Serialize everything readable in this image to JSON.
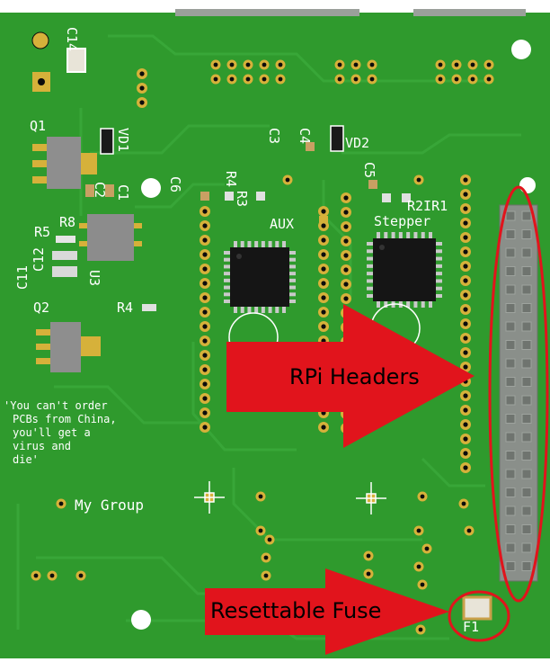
{
  "callouts": {
    "rpi_headers": "RPi Headers",
    "resettable_fuse": "Resettable Fuse"
  },
  "silkscreen": {
    "c14": "C14",
    "q1": "Q1",
    "vd1": "VD1",
    "c2": "C2",
    "c1": "C1",
    "r8": "R8",
    "r5": "R5",
    "c12": "C12",
    "c11": "C11",
    "u3": "U3",
    "q2": "Q2",
    "r4_left": "R4",
    "c3": "C3",
    "c4": "C4",
    "vd2": "VD2",
    "c6": "C6",
    "r4": "R4",
    "r3": "R3",
    "c5": "C5",
    "r2ir1": "R2IR1",
    "aux": "AUX",
    "stepper": "Stepper",
    "f1": "F1",
    "my_group": "My Group",
    "note_line1": "'You can't order",
    "note_line2": "PCBs from China,",
    "note_line3": "you'll get a",
    "note_line4": "virus and",
    "note_line5": "die'"
  },
  "colors": {
    "board": "#2f9a2d",
    "trace": "#3aa83a",
    "pad": "#d6b13a",
    "chip": "#151515",
    "header": "#8a8f8a",
    "callout": "#e1141c",
    "outline": "#e1141c"
  }
}
